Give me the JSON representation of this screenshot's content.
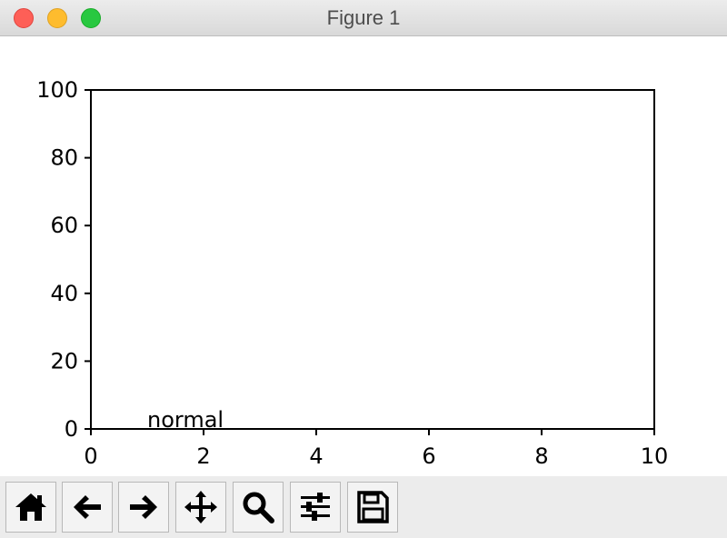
{
  "window": {
    "title": "Figure 1",
    "colors": {
      "close": "#fe5f57",
      "minimize": "#febc2e",
      "zoom": "#28c840"
    }
  },
  "chart_data": {
    "type": "scatter",
    "title": "",
    "xlabel": "",
    "ylabel": "",
    "xlim": [
      0,
      10
    ],
    "ylim": [
      0,
      100
    ],
    "x_ticks": [
      "0",
      "2",
      "4",
      "6",
      "8",
      "10"
    ],
    "y_ticks": [
      "0",
      "20",
      "40",
      "60",
      "80",
      "100"
    ],
    "grid": false,
    "annotations": [
      {
        "text": "normal",
        "x": 1,
        "y": 0
      }
    ],
    "series": []
  },
  "toolbar": {
    "items": [
      {
        "name": "home",
        "icon": "home-icon"
      },
      {
        "name": "back",
        "icon": "arrow-left-icon"
      },
      {
        "name": "forward",
        "icon": "arrow-right-icon"
      },
      {
        "name": "pan",
        "icon": "move-icon"
      },
      {
        "name": "zoom",
        "icon": "search-icon"
      },
      {
        "name": "configure",
        "icon": "sliders-icon"
      },
      {
        "name": "save",
        "icon": "floppy-disk-icon"
      }
    ]
  }
}
